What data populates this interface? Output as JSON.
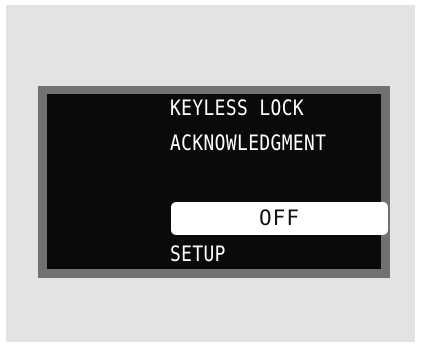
{
  "display": {
    "title_line1": "KEYLESS LOCK",
    "title_line2": "ACKNOWLEDGMENT",
    "selected_option": "OFF",
    "footer": "SETUP"
  },
  "colors": {
    "background": "#e2e3e4",
    "bezel": "#6f7173",
    "screen": "#0a0a0a",
    "text": "#ffffff",
    "highlight": "#ffffff",
    "highlight_text": "#111111"
  }
}
